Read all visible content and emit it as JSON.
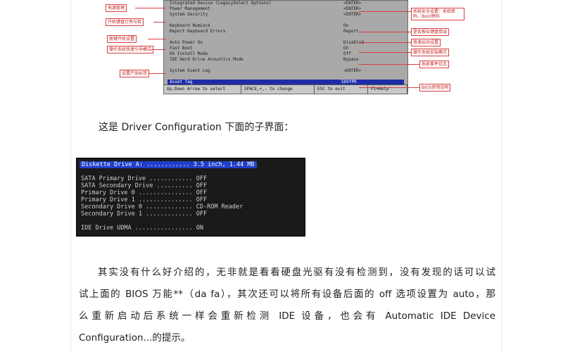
{
  "bios_top": {
    "lines": [
      {
        "label": "Integrated Device (LegacySelect Options)",
        "value": "<ENTER>"
      },
      {
        "label": "Power Management",
        "value": "<ENTER>"
      },
      {
        "label": "System Security",
        "value": "<ENTER>"
      },
      {
        "label": "",
        "value": ""
      },
      {
        "label": "Keyboard NumLock",
        "value": "On"
      },
      {
        "label": "Report Keyboard Errors",
        "value": "Report"
      },
      {
        "label": "",
        "value": ""
      },
      {
        "label": "Auto Power On",
        "value": "Disabled"
      },
      {
        "label": "Fast Boot",
        "value": "On"
      },
      {
        "label": "OS Install Mode",
        "value": "Off"
      },
      {
        "label": "IDE Hard Drive Acoustics Mode",
        "value": "Bypass"
      },
      {
        "label": "",
        "value": ""
      },
      {
        "label": "System Event Log",
        "value": "<ENTER>"
      },
      {
        "label": "",
        "value": ""
      },
      {
        "label": "Asset Tag",
        "value": "5DVYPR"
      }
    ],
    "footer": [
      "Up,Down Arrow to select",
      "SPACE,+,- to change",
      "ESC to exit",
      "F1=Help"
    ],
    "callouts_left": [
      "电源管理",
      "开机键盘灯亮与否",
      "按键开机设置",
      "操作系统快速引导模式",
      "设置产品标签"
    ],
    "callouts_right": [
      "系统安全设置：系统密码、Boot密码",
      "是否报告键盘错误",
      "快速启动设置",
      "操作系统安装模式",
      "系统事件日志",
      "BIOS使用说明"
    ]
  },
  "caption": "这是 Driver Configuration 下面的子界面：",
  "bios2": {
    "rows": [
      "Diskette Drive A: ............ 3.5 inch, 1.44 MB",
      "",
      "SATA Primary Drive ............ OFF",
      "SATA Secondary Drive .......... OFF",
      "Primary Drive 0 ............... OFF",
      "Primary Drive 1 ............... OFF",
      "Secondary Drive 0 ............. CD-ROM Reader",
      "Secondary Drive 1 ............. OFF",
      "",
      "IDE Drive UDMA ................ ON"
    ]
  },
  "paragraph": {
    "lines": [
      "其实没有什么好介绍的，无非就是看看硬盘光驱有没有检测到，没有发现的话可以试",
      "试上面的 BIOS 万能**（da fa），其次还可以将所有设备后面的 off 选项设置为 auto，那",
      "么重新启动后系统一样会重新检测 IDE 设备，也会有 Automatic IDE Device",
      "Configuration...的提示。"
    ]
  },
  "colors": {
    "bios_highlight": "#1f3fc9",
    "callout_red": "#c41e1e"
  }
}
